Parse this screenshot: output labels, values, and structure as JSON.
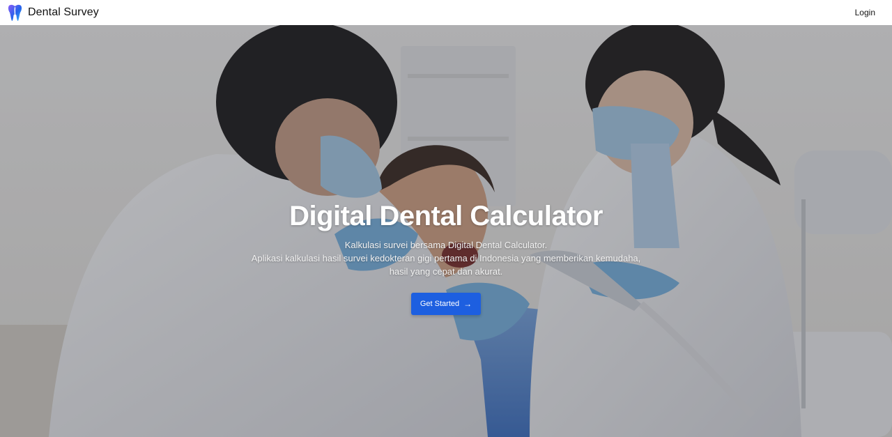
{
  "brand": {
    "name": "Dental Survey",
    "logo_icon": "tooth-icon",
    "logo_colors": [
      "#8b5cf6",
      "#2563eb",
      "#38bdf8"
    ]
  },
  "nav": {
    "login_label": "Login"
  },
  "hero": {
    "title": "Digital Dental Calculator",
    "subtitle_line1": "Kalkulasi survei bersama Digital Dental Calculator.",
    "subtitle_line2": "Aplikasi kalkulasi hasil survei kedokteran gigi pertama di Indonesia yang memberikan kemudaha,",
    "subtitle_line3": "hasil yang cepat dan akurat.",
    "background_image": "dentists-treating-patient-photo",
    "cta": {
      "label": "Get Started",
      "icon": "arrow-right-icon",
      "color": "#1d5fe0"
    }
  }
}
